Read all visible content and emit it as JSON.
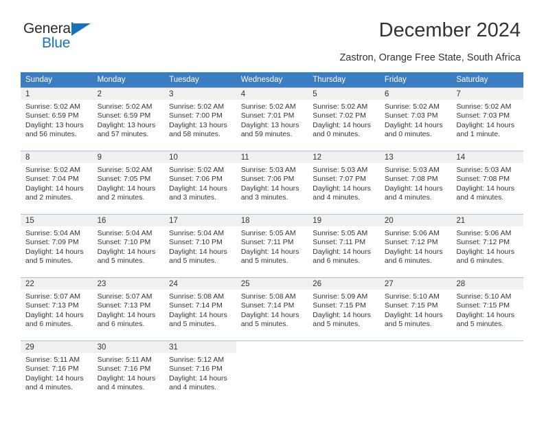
{
  "brand": {
    "name_part1": "General",
    "name_part2": "Blue",
    "triangle_icon": "triangle-icon",
    "color_blue": "#1a72b8",
    "color_dark": "#2b2b2b"
  },
  "header": {
    "title": "December 2024",
    "subtitle": "Zastron, Orange Free State, South Africa"
  },
  "calendar": {
    "header_bg": "#3b7dc0",
    "daynum_bg": "#f0f0f0",
    "gridline": "#a9c2dd",
    "weekdays": [
      "Sunday",
      "Monday",
      "Tuesday",
      "Wednesday",
      "Thursday",
      "Friday",
      "Saturday"
    ],
    "weeks": [
      [
        {
          "day": "1",
          "sunrise": "Sunrise: 5:02 AM",
          "sunset": "Sunset: 6:59 PM",
          "daylight": "Daylight: 13 hours and 56 minutes."
        },
        {
          "day": "2",
          "sunrise": "Sunrise: 5:02 AM",
          "sunset": "Sunset: 6:59 PM",
          "daylight": "Daylight: 13 hours and 57 minutes."
        },
        {
          "day": "3",
          "sunrise": "Sunrise: 5:02 AM",
          "sunset": "Sunset: 7:00 PM",
          "daylight": "Daylight: 13 hours and 58 minutes."
        },
        {
          "day": "4",
          "sunrise": "Sunrise: 5:02 AM",
          "sunset": "Sunset: 7:01 PM",
          "daylight": "Daylight: 13 hours and 59 minutes."
        },
        {
          "day": "5",
          "sunrise": "Sunrise: 5:02 AM",
          "sunset": "Sunset: 7:02 PM",
          "daylight": "Daylight: 14 hours and 0 minutes."
        },
        {
          "day": "6",
          "sunrise": "Sunrise: 5:02 AM",
          "sunset": "Sunset: 7:03 PM",
          "daylight": "Daylight: 14 hours and 0 minutes."
        },
        {
          "day": "7",
          "sunrise": "Sunrise: 5:02 AM",
          "sunset": "Sunset: 7:03 PM",
          "daylight": "Daylight: 14 hours and 1 minute."
        }
      ],
      [
        {
          "day": "8",
          "sunrise": "Sunrise: 5:02 AM",
          "sunset": "Sunset: 7:04 PM",
          "daylight": "Daylight: 14 hours and 2 minutes."
        },
        {
          "day": "9",
          "sunrise": "Sunrise: 5:02 AM",
          "sunset": "Sunset: 7:05 PM",
          "daylight": "Daylight: 14 hours and 2 minutes."
        },
        {
          "day": "10",
          "sunrise": "Sunrise: 5:02 AM",
          "sunset": "Sunset: 7:06 PM",
          "daylight": "Daylight: 14 hours and 3 minutes."
        },
        {
          "day": "11",
          "sunrise": "Sunrise: 5:03 AM",
          "sunset": "Sunset: 7:06 PM",
          "daylight": "Daylight: 14 hours and 3 minutes."
        },
        {
          "day": "12",
          "sunrise": "Sunrise: 5:03 AM",
          "sunset": "Sunset: 7:07 PM",
          "daylight": "Daylight: 14 hours and 4 minutes."
        },
        {
          "day": "13",
          "sunrise": "Sunrise: 5:03 AM",
          "sunset": "Sunset: 7:08 PM",
          "daylight": "Daylight: 14 hours and 4 minutes."
        },
        {
          "day": "14",
          "sunrise": "Sunrise: 5:03 AM",
          "sunset": "Sunset: 7:08 PM",
          "daylight": "Daylight: 14 hours and 4 minutes."
        }
      ],
      [
        {
          "day": "15",
          "sunrise": "Sunrise: 5:04 AM",
          "sunset": "Sunset: 7:09 PM",
          "daylight": "Daylight: 14 hours and 5 minutes."
        },
        {
          "day": "16",
          "sunrise": "Sunrise: 5:04 AM",
          "sunset": "Sunset: 7:10 PM",
          "daylight": "Daylight: 14 hours and 5 minutes."
        },
        {
          "day": "17",
          "sunrise": "Sunrise: 5:04 AM",
          "sunset": "Sunset: 7:10 PM",
          "daylight": "Daylight: 14 hours and 5 minutes."
        },
        {
          "day": "18",
          "sunrise": "Sunrise: 5:05 AM",
          "sunset": "Sunset: 7:11 PM",
          "daylight": "Daylight: 14 hours and 5 minutes."
        },
        {
          "day": "19",
          "sunrise": "Sunrise: 5:05 AM",
          "sunset": "Sunset: 7:11 PM",
          "daylight": "Daylight: 14 hours and 6 minutes."
        },
        {
          "day": "20",
          "sunrise": "Sunrise: 5:06 AM",
          "sunset": "Sunset: 7:12 PM",
          "daylight": "Daylight: 14 hours and 6 minutes."
        },
        {
          "day": "21",
          "sunrise": "Sunrise: 5:06 AM",
          "sunset": "Sunset: 7:12 PM",
          "daylight": "Daylight: 14 hours and 6 minutes."
        }
      ],
      [
        {
          "day": "22",
          "sunrise": "Sunrise: 5:07 AM",
          "sunset": "Sunset: 7:13 PM",
          "daylight": "Daylight: 14 hours and 6 minutes."
        },
        {
          "day": "23",
          "sunrise": "Sunrise: 5:07 AM",
          "sunset": "Sunset: 7:13 PM",
          "daylight": "Daylight: 14 hours and 6 minutes."
        },
        {
          "day": "24",
          "sunrise": "Sunrise: 5:08 AM",
          "sunset": "Sunset: 7:14 PM",
          "daylight": "Daylight: 14 hours and 5 minutes."
        },
        {
          "day": "25",
          "sunrise": "Sunrise: 5:08 AM",
          "sunset": "Sunset: 7:14 PM",
          "daylight": "Daylight: 14 hours and 5 minutes."
        },
        {
          "day": "26",
          "sunrise": "Sunrise: 5:09 AM",
          "sunset": "Sunset: 7:15 PM",
          "daylight": "Daylight: 14 hours and 5 minutes."
        },
        {
          "day": "27",
          "sunrise": "Sunrise: 5:10 AM",
          "sunset": "Sunset: 7:15 PM",
          "daylight": "Daylight: 14 hours and 5 minutes."
        },
        {
          "day": "28",
          "sunrise": "Sunrise: 5:10 AM",
          "sunset": "Sunset: 7:15 PM",
          "daylight": "Daylight: 14 hours and 5 minutes."
        }
      ],
      [
        {
          "day": "29",
          "sunrise": "Sunrise: 5:11 AM",
          "sunset": "Sunset: 7:16 PM",
          "daylight": "Daylight: 14 hours and 4 minutes."
        },
        {
          "day": "30",
          "sunrise": "Sunrise: 5:11 AM",
          "sunset": "Sunset: 7:16 PM",
          "daylight": "Daylight: 14 hours and 4 minutes."
        },
        {
          "day": "31",
          "sunrise": "Sunrise: 5:12 AM",
          "sunset": "Sunset: 7:16 PM",
          "daylight": "Daylight: 14 hours and 4 minutes."
        },
        {
          "day": "",
          "sunrise": "",
          "sunset": "",
          "daylight": ""
        },
        {
          "day": "",
          "sunrise": "",
          "sunset": "",
          "daylight": ""
        },
        {
          "day": "",
          "sunrise": "",
          "sunset": "",
          "daylight": ""
        },
        {
          "day": "",
          "sunrise": "",
          "sunset": "",
          "daylight": ""
        }
      ]
    ]
  }
}
